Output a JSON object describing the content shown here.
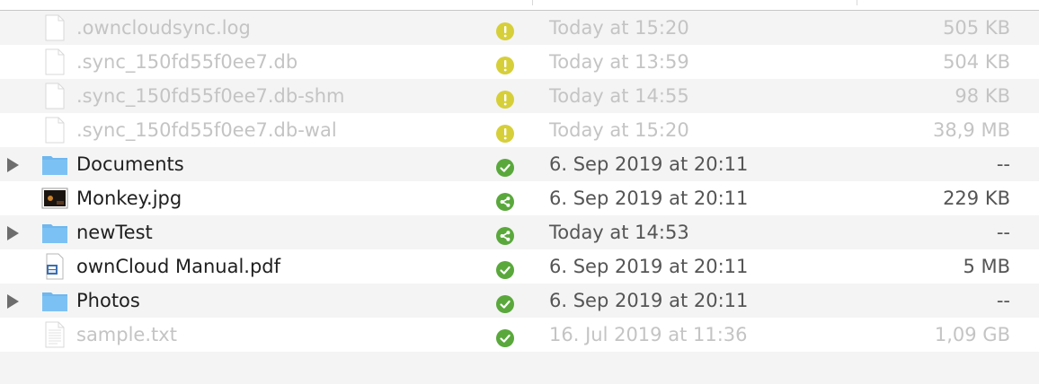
{
  "files": [
    {
      "name": ".owncloudsync.log",
      "date": "Today at 15:20",
      "size": "505 KB",
      "type": "doc",
      "status": "warning-icon",
      "expandable": false,
      "dim": true
    },
    {
      "name": ".sync_150fd55f0ee7.db",
      "date": "Today at 13:59",
      "size": "504 KB",
      "type": "doc",
      "status": "warning-icon",
      "expandable": false,
      "dim": true
    },
    {
      "name": ".sync_150fd55f0ee7.db-shm",
      "date": "Today at 14:55",
      "size": "98 KB",
      "type": "doc",
      "status": "warning-icon",
      "expandable": false,
      "dim": true
    },
    {
      "name": ".sync_150fd55f0ee7.db-wal",
      "date": "Today at 15:20",
      "size": "38,9 MB",
      "type": "doc",
      "status": "warning-icon",
      "expandable": false,
      "dim": true
    },
    {
      "name": "Documents",
      "date": "6. Sep 2019 at 20:11",
      "size": "--",
      "type": "folder",
      "status": "check-icon",
      "expandable": true,
      "dim": false
    },
    {
      "name": "Monkey.jpg",
      "date": "6. Sep 2019 at 20:11",
      "size": "229 KB",
      "type": "image",
      "status": "share-icon",
      "expandable": false,
      "dim": false
    },
    {
      "name": "newTest",
      "date": "Today at 14:53",
      "size": "--",
      "type": "folder",
      "status": "share-icon",
      "expandable": true,
      "dim": false
    },
    {
      "name": "ownCloud Manual.pdf",
      "date": "6. Sep 2019 at 20:11",
      "size": "5 MB",
      "type": "pdf",
      "status": "check-icon",
      "expandable": false,
      "dim": false
    },
    {
      "name": "Photos",
      "date": "6. Sep 2019 at 20:11",
      "size": "--",
      "type": "folder",
      "status": "check-icon",
      "expandable": true,
      "dim": false
    },
    {
      "name": "sample.txt",
      "date": "16. Jul 2019 at 11:36",
      "size": "1,09 GB",
      "type": "text",
      "status": "check-icon",
      "expandable": false,
      "dim": true
    }
  ],
  "colors": {
    "warning": "#d6cf3a",
    "ok": "#5aa83c",
    "folder": "#7cc1f3",
    "stripe": "#f4f4f4"
  }
}
